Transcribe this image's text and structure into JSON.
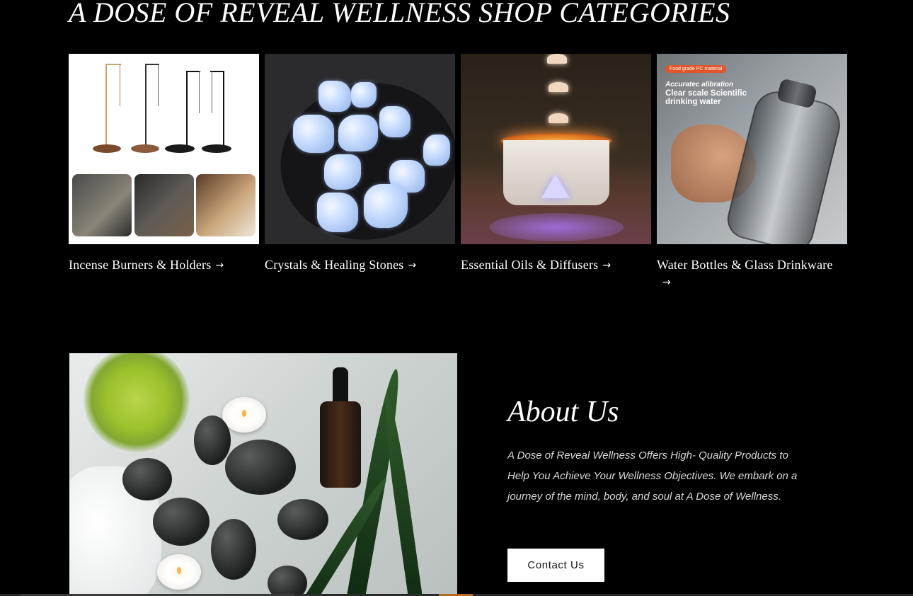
{
  "categories_section": {
    "title": "A DOSE OF REVEAL WELLNESS SHOP CATEGORIES",
    "items": [
      {
        "label": "Incense Burners & Holders",
        "arrow": "→",
        "image_icon": "incense-holder-photo"
      },
      {
        "label": "Crystals & Healing Stones",
        "arrow": "→",
        "image_icon": "crystals-photo"
      },
      {
        "label": "Essential Oils & Diffusers",
        "arrow": "→",
        "image_icon": "diffuser-photo"
      },
      {
        "label": "Water Bottles & Glass Drinkware",
        "arrow": "→",
        "image_icon": "water-bottle-photo"
      }
    ],
    "bottle_image": {
      "badge": "Food grade PC material",
      "headline_1": "Accuratec alibration",
      "headline_2": "Clear scale Scientific drinking water"
    }
  },
  "about_section": {
    "title": "About Us",
    "description": "A Dose of Reveal Wellness Offers High- Quality Products to Help You Achieve Your Wellness Objectives. We embark on a journey of the mind, body, and soul at A Dose of Wellness.",
    "button_label": "Contact Us",
    "image_icon": "spa-stones-photo"
  },
  "colors": {
    "background": "#000000",
    "text": "#ffffff",
    "button_bg": "#ffffff",
    "button_text": "#111111"
  }
}
